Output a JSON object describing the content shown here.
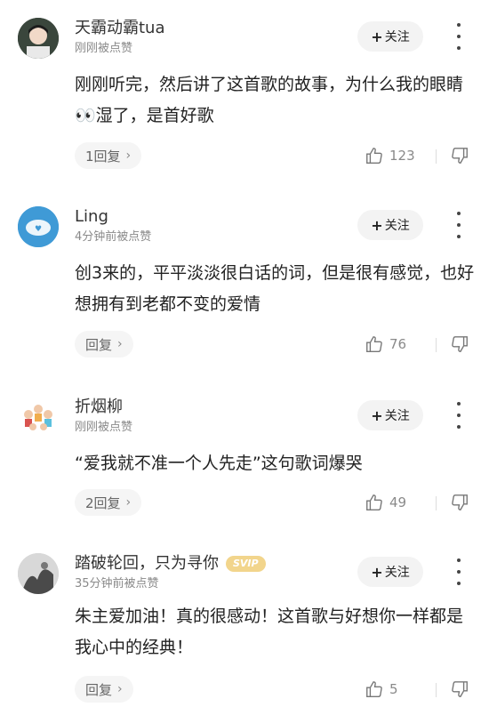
{
  "comments": [
    {
      "username": "天霸动霸tua",
      "meta": "刚刚被点赞",
      "follow_label": "关注",
      "text": "刚刚听完，然后讲了这首歌的故事，为什么我的眼睛👀湿了，是首好歌",
      "reply_label": "1回复",
      "likes": "123"
    },
    {
      "username": "Ling",
      "meta": "4分钟前被点赞",
      "follow_label": "关注",
      "text": "创3来的，平平淡淡很白话的词，但是很有感觉，也好想拥有到老都不变的爱情",
      "reply_label": "回复",
      "likes": "76"
    },
    {
      "username": "折烟柳",
      "meta": "刚刚被点赞",
      "follow_label": "关注",
      "text": "“爱我就不准一个人先走”这句歌词爆哭",
      "reply_label": "2回复",
      "likes": "49"
    },
    {
      "username": "踏破轮回，只为寻你",
      "badge": "SVIP",
      "meta": "35分钟前被点赞",
      "follow_label": "关注",
      "text": "朱主爱加油！真的很感动！这首歌与好想你一样都是我心中的经典！",
      "reply_label": "回复",
      "likes": "5"
    }
  ],
  "icons": {
    "follow": "plus-icon",
    "more": "more-vertical-icon",
    "like": "thumbs-up-icon",
    "dislike": "thumbs-down-icon",
    "reply_chevron": "chevron-right-icon"
  },
  "colors": {
    "badge": "#f2d58c",
    "reply_bg": "#f5f5f5",
    "follow_bg": "#f3f3f3"
  }
}
